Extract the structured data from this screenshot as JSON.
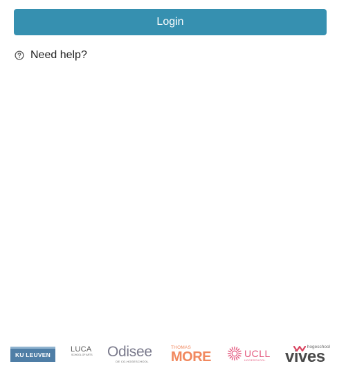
{
  "login": {
    "label": "Login",
    "color": "#3690b0"
  },
  "help": {
    "label": "Need help?",
    "icon": "question-circle-icon"
  },
  "logos": {
    "kuleuven": {
      "text": "KU LEUVEN",
      "color": "#4f7ea6"
    },
    "luca": {
      "main": "LUCA",
      "sub": "SCHOOL OF ARTS"
    },
    "odisee": {
      "main": "Odisee",
      "sub": "DE CO-HOGESCHOOL",
      "color": "#7a7a8c"
    },
    "thomasmore": {
      "top": "THOMAS",
      "main": "MORE",
      "color": "#f1885e"
    },
    "ucll": {
      "main": "UCLL",
      "sub": "HOGESCHOOL",
      "color": "#e4587e"
    },
    "vives": {
      "top": "hogeschool",
      "main": "vives",
      "accent": "#d94460"
    }
  }
}
